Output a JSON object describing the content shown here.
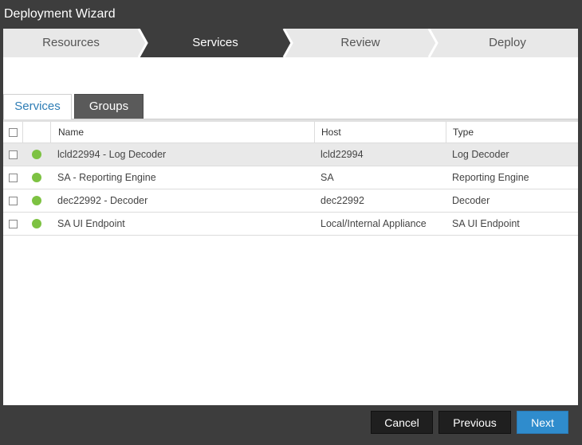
{
  "window": {
    "title": "Deployment Wizard"
  },
  "steps": [
    {
      "label": "Resources",
      "active": false
    },
    {
      "label": "Services",
      "active": true
    },
    {
      "label": "Review",
      "active": false
    },
    {
      "label": "Deploy",
      "active": false
    }
  ],
  "tabs": [
    {
      "label": "Services",
      "active": true
    },
    {
      "label": "Groups",
      "active": false
    }
  ],
  "table": {
    "columns": [
      "Name",
      "Host",
      "Type"
    ],
    "rows": [
      {
        "name": "lcld22994 - Log Decoder",
        "host": "lcld22994",
        "type": "Log Decoder",
        "status": "green",
        "selected": true
      },
      {
        "name": "SA - Reporting Engine",
        "host": "SA",
        "type": "Reporting Engine",
        "status": "green",
        "selected": false
      },
      {
        "name": "dec22992 - Decoder",
        "host": "dec22992",
        "type": "Decoder",
        "status": "green",
        "selected": false
      },
      {
        "name": "SA UI Endpoint",
        "host": "Local/Internal Appliance",
        "type": "SA UI Endpoint",
        "status": "green",
        "selected": false
      }
    ]
  },
  "footer": {
    "cancel": "Cancel",
    "previous": "Previous",
    "next": "Next"
  },
  "colors": {
    "accent": "#2f8ccd",
    "status_ok": "#7dc242",
    "step_active": "#3d3d3d"
  }
}
